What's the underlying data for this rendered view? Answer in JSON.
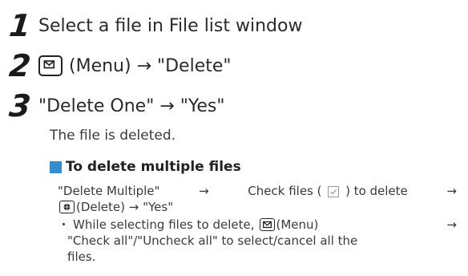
{
  "steps": [
    {
      "num": "1",
      "text": "Select a file in File list window"
    },
    {
      "num": "2",
      "pre_icon": "menu-key-icon",
      "text": "(Menu) → \"Delete\""
    },
    {
      "num": "3",
      "text": "\"Delete One\" → \"Yes\""
    }
  ],
  "note": "The file is deleted.",
  "subsection": {
    "title": "To delete multiple files",
    "line1_a": "\"Delete Multiple\"",
    "line1_b": "→",
    "line1_c": "Check files (",
    "line1_d": ") to delete",
    "line1_e": "→",
    "line2": "(Delete) → \"Yes\"",
    "bullet": "・",
    "line3_a": "While selecting files to delete,",
    "line3_b": "(Menu)",
    "line3_c": "→",
    "line4": "\"Check all\"/\"Uncheck all\" to select/cancel all the",
    "line5": "files."
  },
  "colors": {
    "accent": "#2f8fd0"
  }
}
